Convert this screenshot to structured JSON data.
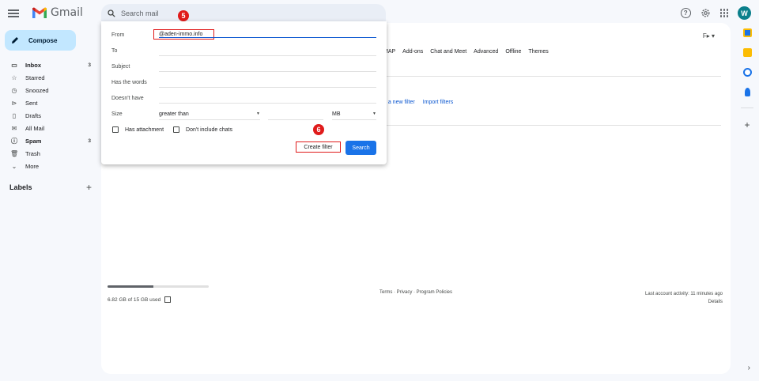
{
  "app": {
    "name": "Gmail"
  },
  "search": {
    "placeholder": "Search mail"
  },
  "avatar": {
    "letter": "W",
    "color": "#0a7f8b"
  },
  "compose": {
    "label": "Compose"
  },
  "sidebar": {
    "items": [
      {
        "label": "Inbox",
        "icon": "inbox-icon",
        "glyph": "▭",
        "count": "3",
        "bold": true
      },
      {
        "label": "Starred",
        "icon": "star-icon",
        "glyph": "☆",
        "count": ""
      },
      {
        "label": "Snoozed",
        "icon": "clock-icon",
        "glyph": "◷",
        "count": ""
      },
      {
        "label": "Sent",
        "icon": "send-icon",
        "glyph": "⊳",
        "count": ""
      },
      {
        "label": "Drafts",
        "icon": "draft-icon",
        "glyph": "▯",
        "count": ""
      },
      {
        "label": "All Mail",
        "icon": "all-mail-icon",
        "glyph": "✉",
        "count": ""
      },
      {
        "label": "Spam",
        "icon": "spam-icon",
        "glyph": "ⓘ",
        "count": "3",
        "bold": true
      },
      {
        "label": "Trash",
        "icon": "trash-icon",
        "glyph": "🗑",
        "count": ""
      },
      {
        "label": "More",
        "icon": "chevron-down-icon",
        "glyph": "⌄",
        "count": ""
      }
    ],
    "labels_heading": "Labels"
  },
  "settings": {
    "tabs": [
      "MAP",
      "Add-ons",
      "Chat and Meet",
      "Advanced",
      "Offline",
      "Themes"
    ],
    "filter_links": [
      "e a new filter",
      "Import filters"
    ]
  },
  "filter_form": {
    "from_label": "From",
    "from_value": "@aden-immo.info",
    "to_label": "To",
    "subject_label": "Subject",
    "has_words_label": "Has the words",
    "doesnt_have_label": "Doesn't have",
    "size_label": "Size",
    "size_operator": "greater than",
    "size_unit": "MB",
    "has_attachment_label": "Has attachment",
    "no_chats_label": "Don't include chats",
    "create_filter_label": "Create filter",
    "search_label": "Search"
  },
  "annotations": {
    "step5": "5",
    "step6": "6",
    "color": "#e01b1b"
  },
  "storage": {
    "text": "6.82 GB of 15 GB used",
    "used_fraction": 0.45
  },
  "footer": {
    "links": "Terms · Privacy · Program Policies",
    "activity": "Last account activity: 11 minutes ago",
    "details": "Details"
  },
  "colors": {
    "accent": "#0b57d0",
    "compose_bg": "#c2e7ff",
    "search_button": "#1a73e8"
  }
}
